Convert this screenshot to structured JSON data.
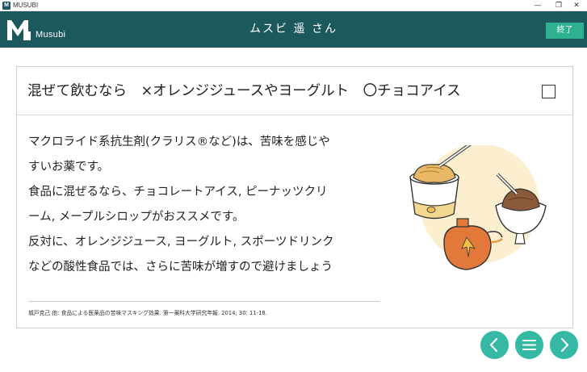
{
  "window": {
    "app_title": "MUSUBI",
    "minimize_glyph": "—",
    "maximize_glyph": "❐",
    "close_glyph": "✕"
  },
  "header": {
    "logo_text": "Musubi",
    "patient_name": "ムスビ 遥 さん",
    "end_button_label": "終了",
    "background_color": "#1c595d",
    "accent_color": "#2fb090"
  },
  "card": {
    "heading": "混ぜて飲むなら　×オレンジジュースやヨーグルト　〇チョコアイス",
    "checkbox_checked": false,
    "body_lines": [
      "マクロライド系抗生剤(クラリス®など)は、苦味を感じや",
      "すいお薬です。",
      "食品に混ぜるなら、チョコレートアイス, ピーナッツクリ",
      "ーム, メープルシロップがおススメです。",
      "反対に、オレンジジュース, ヨーグルト, スポーツドリンク",
      "などの酸性食品では、さらに苦味が増すので避けましょう"
    ],
    "reference": "城戸克己 他: 食品による医薬品の苦味マスキング効果. 第一薬科大学研究年報. 2014; 30: 11-18.",
    "illustration_icon": "dessert-foods-illustration"
  },
  "navigation": {
    "prev_icon": "chevron-left-icon",
    "menu_icon": "menu-icon",
    "next_icon": "chevron-right-icon",
    "button_color": "#35b8a4"
  }
}
